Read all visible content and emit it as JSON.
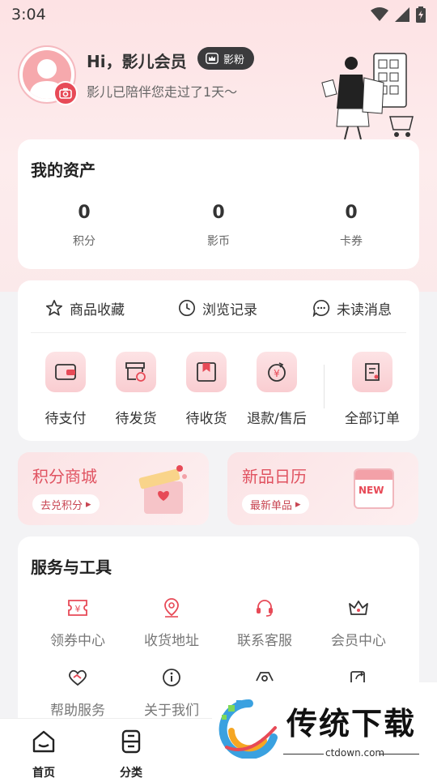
{
  "status_bar": {
    "time": "3:04"
  },
  "profile": {
    "greeting": "Hi，影儿会员",
    "badge": "影粉",
    "subtitle": "影儿已陪伴您走过了1天～"
  },
  "assets": {
    "title": "我的资产",
    "items": [
      {
        "value": "0",
        "label": "积分"
      },
      {
        "value": "0",
        "label": "影币"
      },
      {
        "value": "0",
        "label": "卡券"
      }
    ]
  },
  "quick_links": [
    {
      "label": "商品收藏",
      "icon": "star-icon"
    },
    {
      "label": "浏览记录",
      "icon": "clock-icon"
    },
    {
      "label": "未读消息",
      "icon": "message-icon"
    }
  ],
  "orders": [
    {
      "label": "待支付",
      "icon": "wallet-icon"
    },
    {
      "label": "待发货",
      "icon": "box-clock-icon"
    },
    {
      "label": "待收货",
      "icon": "package-icon"
    },
    {
      "label": "退款/售后",
      "icon": "refund-icon"
    },
    {
      "label": "全部订单",
      "icon": "order-list-icon"
    }
  ],
  "promos": [
    {
      "title": "积分商城",
      "action": "去兑积分"
    },
    {
      "title": "新品日历",
      "action": "最新单品"
    }
  ],
  "promo_calendar_text": "NEW",
  "services": {
    "title": "服务与工具",
    "items": [
      {
        "label": "领券中心",
        "icon": "coupon-icon"
      },
      {
        "label": "收货地址",
        "icon": "location-icon"
      },
      {
        "label": "联系客服",
        "icon": "headset-icon"
      },
      {
        "label": "会员中心",
        "icon": "crown-icon"
      },
      {
        "label": "帮助服务",
        "icon": "heart-hand-icon"
      },
      {
        "label": "关于我们",
        "icon": "info-icon"
      }
    ]
  },
  "tabbar": [
    {
      "label": "首页",
      "icon": "home-icon"
    },
    {
      "label": "分类",
      "icon": "category-icon"
    }
  ],
  "watermark": {
    "text": "传统下载",
    "url": "ctdown.com"
  },
  "colors": {
    "accent": "#e74a57",
    "promo_title": "#e05260",
    "badge_bg": "#3b3b3d"
  }
}
